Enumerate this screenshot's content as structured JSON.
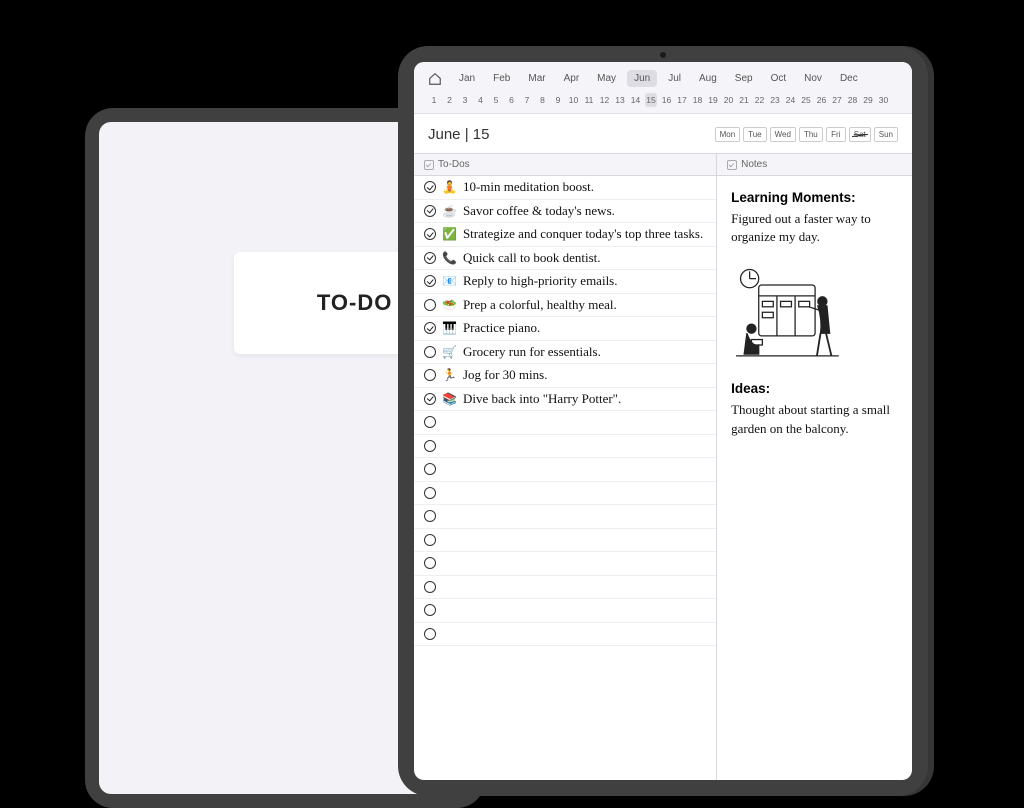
{
  "back": {
    "title": "TO-DO LIST"
  },
  "nav": {
    "months": [
      "Jan",
      "Feb",
      "Mar",
      "Apr",
      "May",
      "Jun",
      "Jul",
      "Aug",
      "Sep",
      "Oct",
      "Nov",
      "Dec"
    ],
    "activeMonth": "Jun",
    "days": [
      1,
      2,
      3,
      4,
      5,
      6,
      7,
      8,
      9,
      10,
      11,
      12,
      13,
      14,
      15,
      16,
      17,
      18,
      19,
      20,
      21,
      22,
      23,
      24,
      25,
      26,
      27,
      28,
      29,
      30
    ],
    "activeDay": 15
  },
  "dateHeader": {
    "label": "June | 15",
    "weekdays": [
      "Mon",
      "Tue",
      "Wed",
      "Thu",
      "Fri",
      "Sat",
      "Sun"
    ],
    "strikeDay": "Sat"
  },
  "sections": {
    "todosLabel": "To-Dos",
    "notesLabel": "Notes"
  },
  "todos": [
    {
      "checked": true,
      "emoji": "🧘",
      "text": "10-min meditation boost."
    },
    {
      "checked": true,
      "emoji": "☕",
      "text": "Savor coffee & today's news."
    },
    {
      "checked": true,
      "emoji": "✅",
      "text": "Strategize and conquer today's top three tasks."
    },
    {
      "checked": true,
      "emoji": "📞",
      "text": "Quick call to book dentist."
    },
    {
      "checked": true,
      "emoji": "📧",
      "text": "Reply to high-priority emails."
    },
    {
      "checked": false,
      "emoji": "🥗",
      "text": "Prep a colorful, healthy meal."
    },
    {
      "checked": true,
      "emoji": "🎹",
      "text": "Practice piano."
    },
    {
      "checked": false,
      "emoji": "🛒",
      "text": "Grocery run for essentials."
    },
    {
      "checked": false,
      "emoji": "🏃",
      "text": "Jog for 30 mins."
    },
    {
      "checked": true,
      "emoji": "📚",
      "text": "Dive back into \"Harry Potter\"."
    }
  ],
  "emptyTodoRows": 10,
  "notes": {
    "learning": {
      "heading": "Learning Moments:",
      "body": "Figured out a faster way to organize my day."
    },
    "ideas": {
      "heading": "Ideas:",
      "body": "Thought about starting a small garden on the balcony."
    }
  }
}
